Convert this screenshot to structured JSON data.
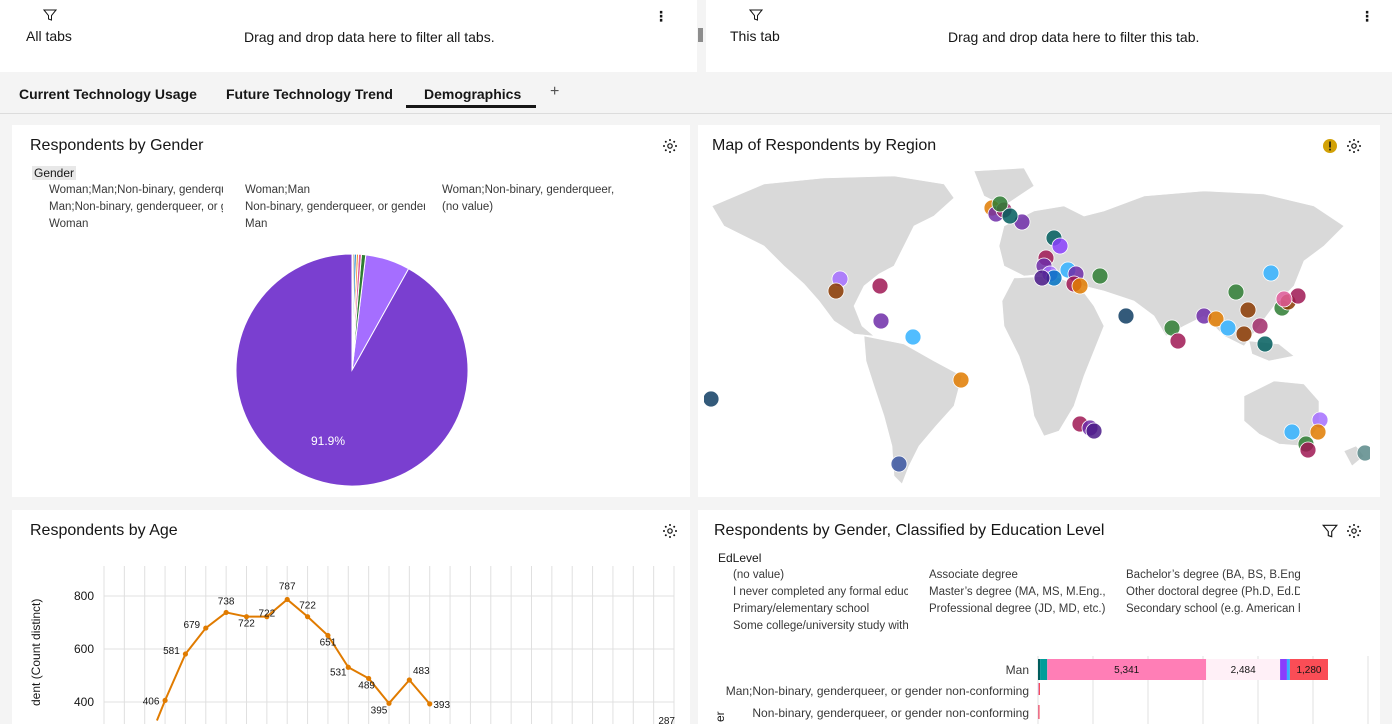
{
  "filter_bar": {
    "all_tabs": {
      "label": "All tabs",
      "drop_text": "Drag and drop data here to filter all tabs."
    },
    "this_tab": {
      "label": "This tab",
      "drop_text": "Drag and drop data here to filter this tab."
    }
  },
  "tabs": [
    {
      "label": "Current Technology Usage",
      "active": false
    },
    {
      "label": "Future Technology Trend",
      "active": false
    },
    {
      "label": "Demographics",
      "active": true
    }
  ],
  "add_tab_label": "+",
  "icons": {
    "filter": "filter-icon",
    "kebab": "overflow-menu-icon",
    "settings": "settings-icon",
    "warning": "warning-icon"
  },
  "gender_card": {
    "title": "Respondents by Gender",
    "legend_title": "Gender",
    "legend_items": [
      "Woman;Man;Non-binary, genderqueer, or gender non-conforming",
      "Woman;Man",
      "Woman;Non-binary, genderqueer, or gender non-conforming",
      "Man;Non-binary, genderqueer, or gender non-conforming",
      "Non-binary, genderqueer, or gender",
      "(no value)",
      "Woman",
      "Man"
    ],
    "slice_label": "91.9%"
  },
  "map_card": {
    "title": "Map of Respondents by Region"
  },
  "age_card": {
    "title": "Respondents by Age",
    "ylabel": "dent (Count distinct)",
    "yticks": [
      "800",
      "600",
      "400"
    ],
    "data_labels": [
      "406",
      "581",
      "679",
      "738",
      "722",
      "722",
      "787",
      "722",
      "651",
      "531",
      "489",
      "395",
      "483",
      "393",
      "287"
    ]
  },
  "edu_card": {
    "title": "Respondents by Gender, Classified by Education Level",
    "legend_title": "EdLevel",
    "legend_items": [
      "(no value)",
      "Associate degree",
      "Bachelor’s degree (BA, BS, B.Eng., etc.)",
      "I never completed any formal education",
      "Master’s degree (MA, MS, M.Eng., MBA, etc.)",
      "Other doctoral degree (Ph.D, Ed.D., etc.)",
      "Primary/elementary school",
      "Professional degree (JD, MD, etc.)",
      "Secondary school (e.g. American high school)",
      "Some college/university study without earning a degree"
    ],
    "rows": [
      "Man",
      "Man;Non-binary, genderqueer, or gender non-conforming",
      "Non-binary, genderqueer, or gender non-conforming"
    ],
    "bar_labels": [
      "5,341",
      "2,484",
      "1,280"
    ],
    "ylabel": "er"
  },
  "chart_data": [
    {
      "type": "pie",
      "title": "Respondents by Gender",
      "legend_title": "Gender",
      "labels": [
        "Man",
        "Woman",
        "Non-binary, genderqueer, or gender",
        "Woman;Man",
        "Woman;Non-binary, genderqueer, or gender non-conforming",
        "Man;Non-binary, genderqueer, or gender non-conforming",
        "(no value)",
        "Woman;Man;Non-binary, genderqueer, or gender non-conforming"
      ],
      "values": [
        91.9,
        6.2,
        0.6,
        0.4,
        0.3,
        0.3,
        0.2,
        0.1
      ],
      "colors": [
        "#7a3fd0",
        "#a56eff",
        "#2e7d32",
        "#e05a9a",
        "#f08a24",
        "#0072c3",
        "#8a3800",
        "#005d5d"
      ],
      "data_labels": [
        "91.9%"
      ]
    },
    {
      "type": "line",
      "title": "Respondents by Age",
      "ylabel": "dent (Count distinct)",
      "yticks": [
        400,
        600,
        800
      ],
      "x_index": [
        1,
        2,
        3,
        4,
        5,
        6,
        7,
        8,
        9,
        10,
        11,
        12,
        13,
        14
      ],
      "values": [
        406,
        581,
        679,
        738,
        722,
        722,
        787,
        722,
        651,
        531,
        489,
        395,
        483,
        393
      ],
      "extra_label": 287,
      "color": "#e07b00"
    },
    {
      "type": "bar",
      "title": "Respondents by Gender, Classified by Education Level",
      "orientation": "horizontal-stacked",
      "categories": [
        "Man",
        "Man;Non-binary, genderqueer, or gender non-conforming",
        "Non-binary, genderqueer, or gender non-conforming"
      ],
      "series": [
        {
          "name": "(no value)",
          "values": [
            70,
            3,
            2
          ]
        },
        {
          "name": "Associate degree",
          "values": [
            240,
            1,
            1
          ]
        },
        {
          "name": "Bachelor’s degree (BA, BS, B.Eng., etc.)",
          "values": [
            5341,
            20,
            10
          ]
        },
        {
          "name": "Master’s degree (MA, MS, M.Eng., MBA, etc.)",
          "values": [
            2484,
            8,
            4
          ]
        },
        {
          "name": "Other doctoral degree (Ph.D, Ed.D., etc.)",
          "values": [
            230,
            1,
            1
          ]
        },
        {
          "name": "Professional degree (JD, MD, etc.)",
          "values": [
            100,
            0,
            0
          ]
        },
        {
          "name": "Secondary school (e.g. American high school)",
          "values": [
            1280,
            6,
            3
          ]
        }
      ],
      "colors": [
        "#005d5d",
        "#009d9a",
        "#ff7eb6",
        "#fff0f7",
        "#8a3ffc",
        "#33b1ff",
        "#fa4d56"
      ],
      "data_labels": [
        "5,341",
        "2,484",
        "1,280"
      ]
    }
  ]
}
